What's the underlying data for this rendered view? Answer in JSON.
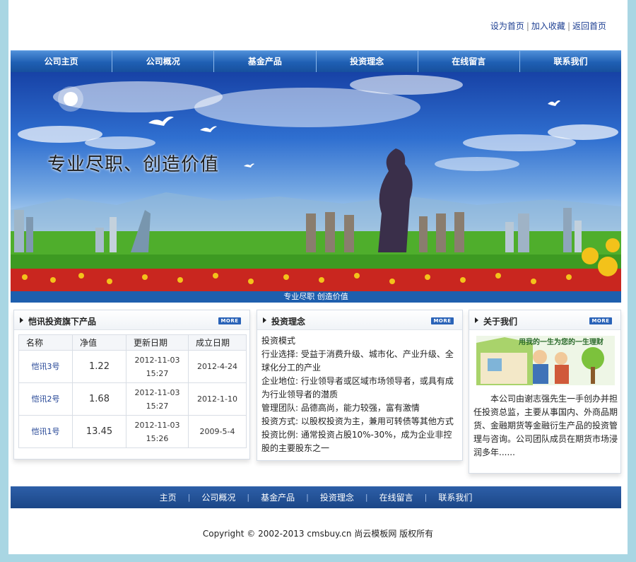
{
  "toplinks": {
    "set_home": "设为首页",
    "bookmark": "加入收藏",
    "back_home": "返回首页",
    "separator": "|"
  },
  "nav": {
    "items": [
      {
        "label": "公司主页"
      },
      {
        "label": "公司概况"
      },
      {
        "label": "基金产品"
      },
      {
        "label": "投资理念"
      },
      {
        "label": "在线留言"
      },
      {
        "label": "联系我们"
      }
    ]
  },
  "banner": {
    "slogan": "专业尽职、创造价值",
    "caption": "专业尽职 创造价值"
  },
  "products": {
    "title": "恺讯投资旗下产品",
    "more": "MORE",
    "columns": [
      "名称",
      "净值",
      "更新日期",
      "成立日期"
    ],
    "rows": [
      {
        "name": "恺讯3号",
        "nav": "1.22",
        "update_date": "2012-11-03",
        "update_time": "15:27",
        "established": "2012-4-24"
      },
      {
        "name": "恺讯2号",
        "nav": "1.68",
        "update_date": "2012-11-03",
        "update_time": "15:27",
        "established": "2012-1-10"
      },
      {
        "name": "恺讯1号",
        "nav": "13.45",
        "update_date": "2012-11-03",
        "update_time": "15:26",
        "established": "2009-5-4"
      }
    ]
  },
  "philosophy": {
    "title": "投资理念",
    "more": "MORE",
    "lines": [
      "投资模式",
      "行业选择: 受益于消费升级、城市化、产业升级、全球化分工的产业",
      "企业地位: 行业领导者或区域市场领导者，或具有成为行业领导者的潜质",
      "管理团队: 品德高尚，能力较强，富有激情",
      "投资方式: 以股权投资为主，兼用可转债等其他方式",
      "投资比例: 通常投资占股10%-30%，成为企业非控股的主要股东之一"
    ]
  },
  "about": {
    "title": "关于我们",
    "more": "MORE",
    "illustration_text": "用我的一生为您的一生理财",
    "text": "本公司由谢志强先生一手创办并担任投资总监，主要从事国内、外商品期货、金融期货等金融衍生产品的投资管理与咨询。公司团队成员在期货市场浸润多年......"
  },
  "footer_nav": {
    "items": [
      {
        "label": "主页"
      },
      {
        "label": "公司概况"
      },
      {
        "label": "基金产品"
      },
      {
        "label": "投资理念"
      },
      {
        "label": "在线留言"
      },
      {
        "label": "联系我们"
      }
    ],
    "separator": "|"
  },
  "copyright": "Copyright © 2002-2013 cmsbuy.cn 尚云模板网 版权所有",
  "colors": {
    "nav_bg": "#1f5fb3",
    "footer_bg": "#1b4687",
    "link": "#1d3f92",
    "page_bg": "#a9d6e3"
  }
}
